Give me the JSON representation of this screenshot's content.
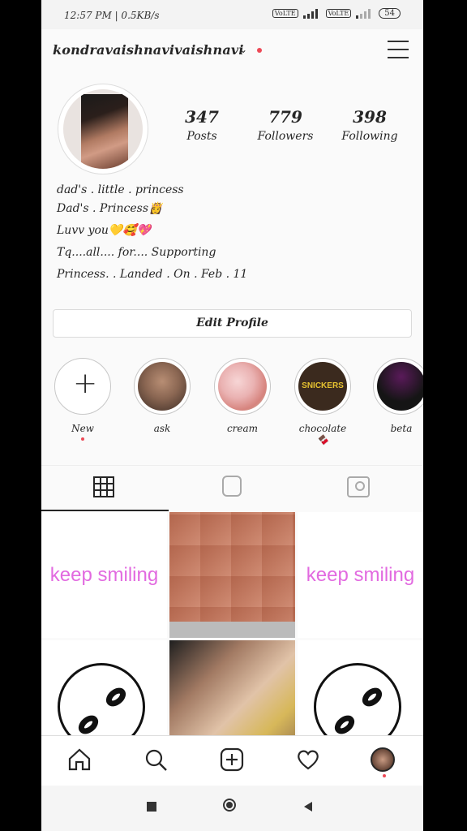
{
  "status_bar": {
    "time": "12:57 PM | 0.5KB/s",
    "sim1": "VoLTE",
    "sim2": "VoLTE",
    "battery": "54"
  },
  "profile": {
    "username": "kondravaishnavivaishnavi",
    "stats": [
      {
        "num": "347",
        "label": "Posts"
      },
      {
        "num": "779",
        "label": "Followers"
      },
      {
        "num": "398",
        "label": "Following"
      }
    ],
    "bio": [
      "dad's . little . princess",
      "Dad's . Princess👸",
      " Luvv you💛🥰💖",
      "Tq....all.... for.... Supporting",
      "Princess.    .    Landed   .   On    .    Feb . 11"
    ],
    "edit_label": "Edit Profile"
  },
  "highlights": [
    {
      "label": "New",
      "icon": "plus-icon"
    },
    {
      "label": "ask"
    },
    {
      "label": "cream"
    },
    {
      "label": "chocolate🍫",
      "img_text": "SNICKERS"
    },
    {
      "label": "beta"
    }
  ],
  "tabs": [
    {
      "name": "grid",
      "icon": "grid-icon",
      "active": true
    },
    {
      "name": "igtv",
      "icon": "tv-icon",
      "active": false
    },
    {
      "name": "tagged",
      "icon": "tagged-icon",
      "active": false
    }
  ],
  "posts": [
    {
      "type": "text",
      "text": "keep smiling"
    },
    {
      "type": "image",
      "desc": "collage"
    },
    {
      "type": "text",
      "text": "keep smiling"
    },
    {
      "type": "image",
      "desc": "broken-chain"
    },
    {
      "type": "image",
      "desc": "selfie"
    },
    {
      "type": "image",
      "desc": "broken-chain"
    }
  ],
  "bottom_nav": [
    "home-icon",
    "search-icon",
    "add-post-icon",
    "heart-icon",
    "profile-avatar"
  ],
  "colors": {
    "accent_red": "#ed4956",
    "smile_text": "#e26ae0"
  }
}
